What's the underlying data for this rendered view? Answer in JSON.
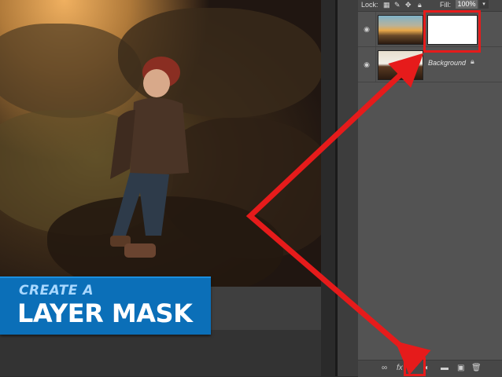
{
  "banner": {
    "line1": "CREATE A",
    "line2": "LAYER MASK"
  },
  "layers_panel": {
    "lock_label": "Lock:",
    "fill_label": "Fill:",
    "fill_value": "100%",
    "fill_arrow": "▾",
    "layers": [
      {
        "name": "",
        "thumbnail": "sunset-sky",
        "has_mask": true
      },
      {
        "name": "Background",
        "thumbnail": "background-photo",
        "locked": true
      }
    ],
    "footer_icons": [
      "link-icon",
      "fx-icon",
      "add-layer-mask-icon",
      "adjustment-layer-icon",
      "group-folder-icon",
      "new-layer-icon",
      "trash-icon"
    ]
  },
  "colors": {
    "banner_blue": "#0b6fb8",
    "highlight_red": "#e61b1b",
    "panel_gray": "#535353"
  }
}
